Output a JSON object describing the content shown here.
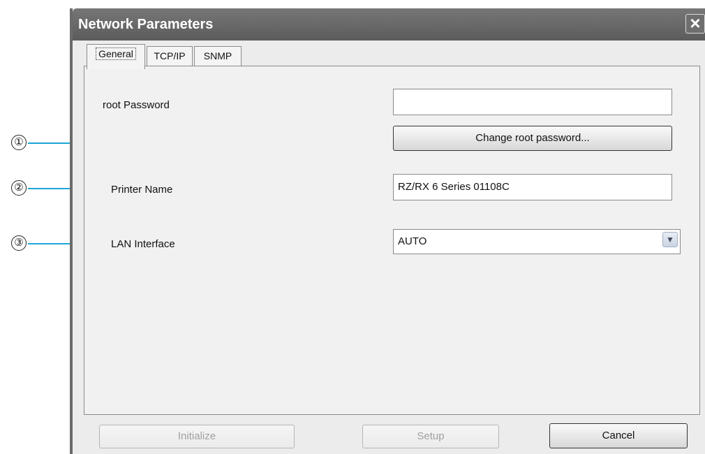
{
  "callouts": [
    "①",
    "②",
    "③"
  ],
  "window": {
    "title": "Network Parameters",
    "close_icon": "×"
  },
  "tabs": [
    {
      "label": "General",
      "active": true
    },
    {
      "label": "TCP/IP",
      "active": false
    },
    {
      "label": "SNMP",
      "active": false
    }
  ],
  "general": {
    "root_password_label": "root Password",
    "root_password_value": "",
    "change_password_button": "Change root password...",
    "printer_name_label": "Printer Name",
    "printer_name_value": "RZ/RX 6 Series 01108C",
    "lan_interface_label": "LAN Interface",
    "lan_interface_value": "AUTO",
    "dropdown_icon": "chevron-down-icon"
  },
  "footer": {
    "initialize_button": "Initialize",
    "setup_button": "Setup",
    "cancel_button": "Cancel"
  },
  "colors": {
    "callout_line": "#1ea6d8",
    "titlebar": "#666666"
  }
}
